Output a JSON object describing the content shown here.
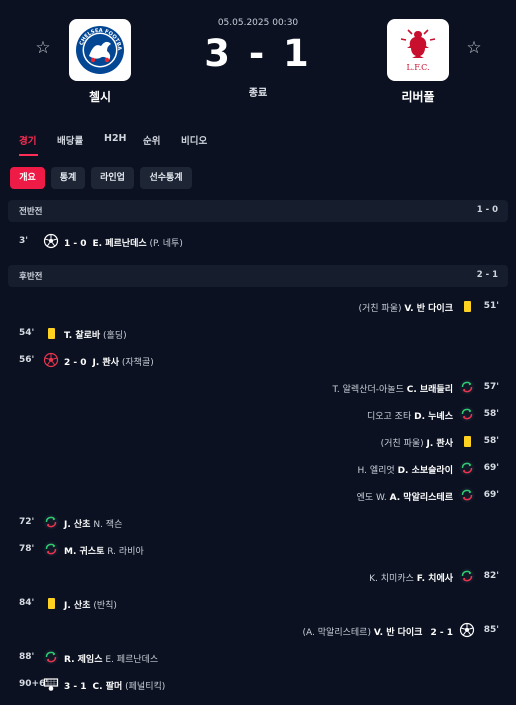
{
  "match": {
    "date": "05.05.2025 00:30",
    "score": "3 - 1",
    "status": "종료",
    "home": {
      "name": "첼시",
      "crest_text": "CHELSEA FOOTBALL CLUB",
      "crest_color": "#034694"
    },
    "away": {
      "name": "리버풀",
      "crest_text": "L.F.C.",
      "crest_color": "#c8102e"
    }
  },
  "tabs": [
    "경기",
    "배당률",
    "H2H",
    "순위",
    "비디오"
  ],
  "subtabs": [
    "개요",
    "통계",
    "라인업",
    "선수통계"
  ],
  "periods": [
    {
      "name": "전반전",
      "score": "1 - 0"
    },
    {
      "name": "후반전",
      "score": "2 - 1"
    }
  ],
  "events": [
    {
      "side": "home",
      "minute": "3'",
      "type": "goal",
      "score": "1 - 0",
      "player": "E. 페르난데스",
      "detail": "(P. 네투)"
    },
    {
      "side": "away",
      "minute": "51'",
      "type": "yellow-card",
      "player": "V. 반 다이크",
      "detail": "(거친 파울)"
    },
    {
      "side": "home",
      "minute": "54'",
      "type": "yellow-card",
      "player": "T. 찰로바",
      "detail": "(홀딩)"
    },
    {
      "side": "home",
      "minute": "56'",
      "type": "own-goal",
      "score": "2 - 0",
      "player": "J. 콴사",
      "detail": "(자책골)"
    },
    {
      "side": "away",
      "minute": "57'",
      "type": "substitution",
      "player": "C. 브래들리",
      "detail": "T. 알렉산더-아놀드"
    },
    {
      "side": "away",
      "minute": "58'",
      "type": "substitution",
      "player": "D. 누녜스",
      "detail": "디오고 조타"
    },
    {
      "side": "away",
      "minute": "58'",
      "type": "yellow-card",
      "player": "J. 콴사",
      "detail": "(거친 파울)"
    },
    {
      "side": "away",
      "minute": "69'",
      "type": "substitution",
      "player": "D. 소보슬라이",
      "detail": "H. 엘리엇"
    },
    {
      "side": "away",
      "minute": "69'",
      "type": "substitution",
      "player": "A. 막알리스테르",
      "detail": "엔도 W."
    },
    {
      "side": "home",
      "minute": "72'",
      "type": "substitution",
      "player": "J. 산초",
      "detail": "N. 잭슨"
    },
    {
      "side": "home",
      "minute": "78'",
      "type": "substitution",
      "player": "M. 귀스토",
      "detail": "R. 라비아"
    },
    {
      "side": "away",
      "minute": "82'",
      "type": "substitution",
      "player": "F. 치에사",
      "detail": "K. 치미카스"
    },
    {
      "side": "home",
      "minute": "84'",
      "type": "yellow-card",
      "player": "J. 산초",
      "detail": "(반칙)"
    },
    {
      "side": "away",
      "minute": "85'",
      "type": "goal",
      "score": "2 - 1",
      "player": "V. 반 다이크",
      "detail": "(A. 막알리스테르)"
    },
    {
      "side": "home",
      "minute": "88'",
      "type": "substitution",
      "player": "R. 제임스",
      "detail": "E. 페르난데스"
    },
    {
      "side": "home",
      "minute": "90+6'",
      "type": "penalty-goal",
      "score": "3 - 1",
      "player": "C. 팔머",
      "detail": "(페널티킥)"
    }
  ],
  "colors": {
    "accent": "#ff2d55",
    "yellow_card": "#ffd21f",
    "sub_in": "#2ecc71",
    "sub_out": "#e8344e",
    "background": "#0b1121"
  }
}
